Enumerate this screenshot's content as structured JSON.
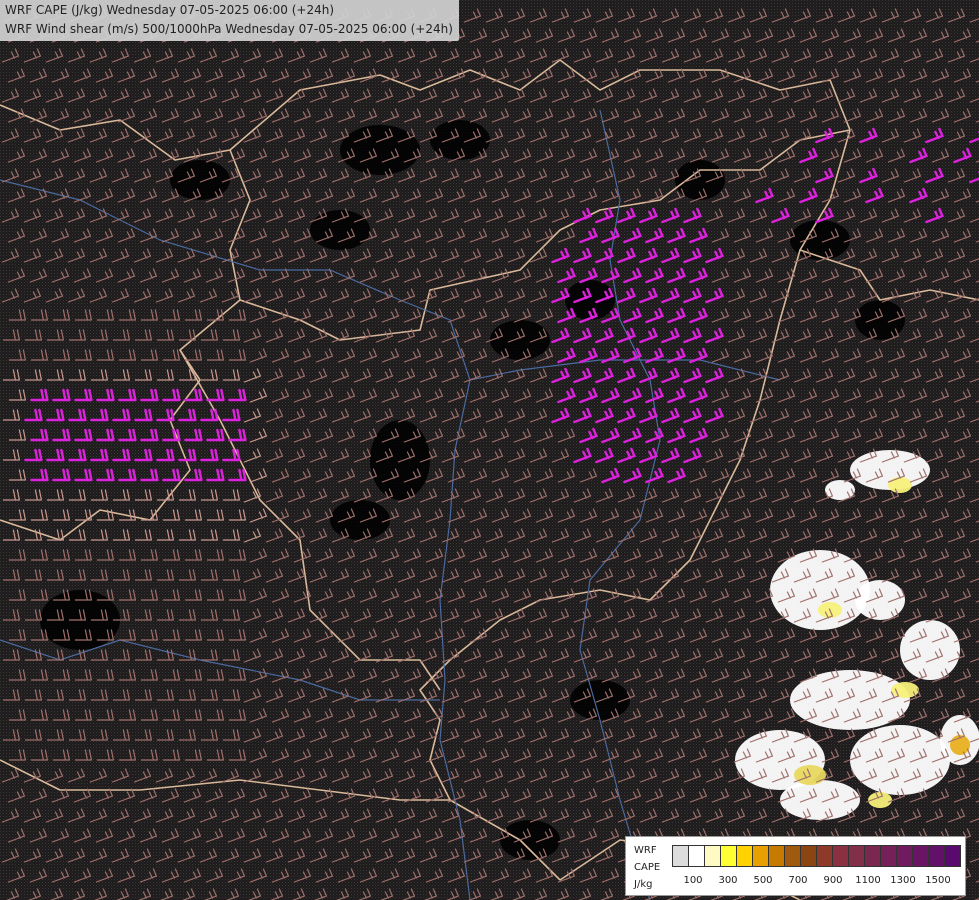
{
  "header": {
    "line1": "WRF CAPE (J/kg) Wednesday 07-05-2025 06:00 (+24h)",
    "line2": "WRF Wind shear (m/s) 500/1000hPa Wednesday 07-05-2025 06:00 (+24h)"
  },
  "legend": {
    "label_line1": "WRF",
    "label_line2": "CAPE",
    "label_line3": "J/kg",
    "colors": [
      "#dcdcdc",
      "#ffffff",
      "#fff9c4",
      "#ffff33",
      "#ffd200",
      "#e8a000",
      "#c77a00",
      "#a05a10",
      "#8b4513",
      "#8e3a2a",
      "#8a3040",
      "#82304a",
      "#7a2850",
      "#76205a",
      "#701a60",
      "#6a1466",
      "#62106a",
      "#5a0a6e"
    ],
    "ticks": [
      "100",
      "300",
      "500",
      "700",
      "900",
      "1100",
      "1300",
      "1500"
    ]
  },
  "map_colors": {
    "barb_low": "#a0706c",
    "barb_mid": "#7b4d4d",
    "barb_high": "#dd22dd",
    "barb_west": "#c9998f",
    "border": "#d9b99a",
    "river": "#4a6aa0",
    "terrain": "#3d3838"
  }
}
